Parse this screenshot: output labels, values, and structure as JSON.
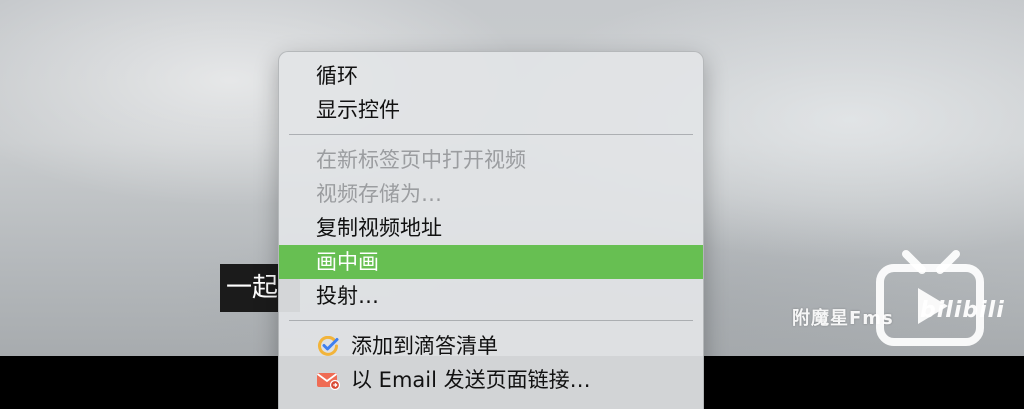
{
  "video": {
    "subtitle_partial": "一起",
    "watermark": "附魔星Fms",
    "logo_text": "bilibili"
  },
  "context_menu": {
    "group1": [
      {
        "label": "循环",
        "enabled": true
      },
      {
        "label": "显示控件",
        "enabled": true
      }
    ],
    "group2": [
      {
        "label": "在新标签页中打开视频",
        "enabled": false
      },
      {
        "label": "视频存储为…",
        "enabled": false
      },
      {
        "label": "复制视频地址",
        "enabled": true
      },
      {
        "label": "画中画",
        "enabled": true,
        "highlighted": true
      },
      {
        "label": "投射…",
        "enabled": true
      }
    ],
    "group3": [
      {
        "label": "添加到滴答清单",
        "enabled": true,
        "icon": "check-circle-icon"
      },
      {
        "label": "以 Email 发送页面链接…",
        "enabled": true,
        "icon": "mail-icon"
      }
    ]
  },
  "colors": {
    "highlight": "#67bf52",
    "menu_bg": "#e2e4e6",
    "disabled_text": "#9b9da0",
    "checklist_icon": "#f2b43a",
    "mail_icon": "#ef6c55"
  }
}
